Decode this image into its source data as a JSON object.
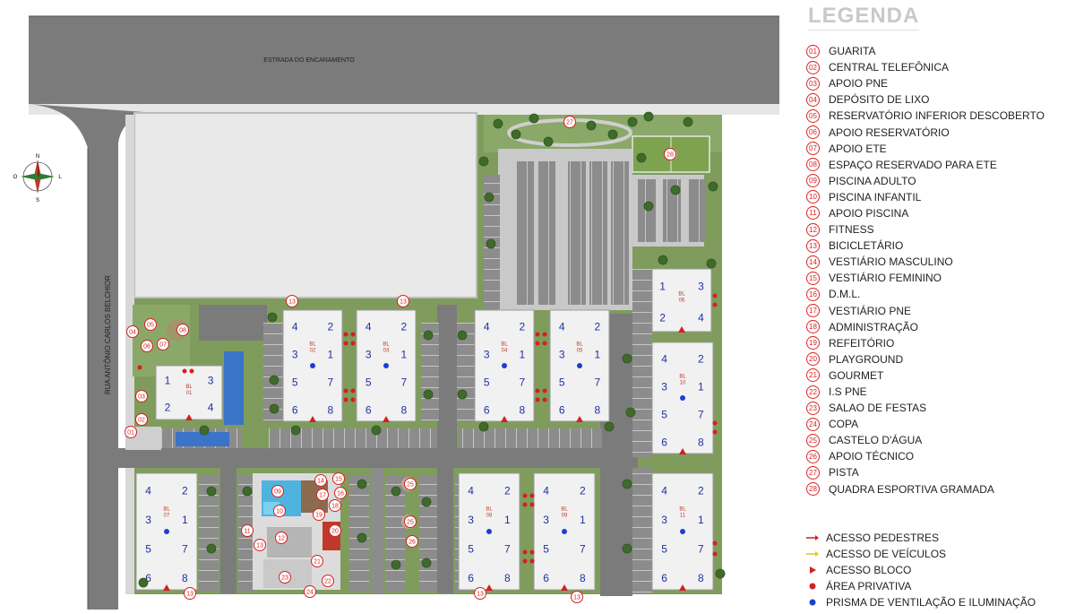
{
  "map": {
    "road_top": "ESTRADA DO ENCANAMENTO",
    "road_left": "RUA ANTÔNIO CARLOS BELCHIOR",
    "compass": {
      "n": "N",
      "s": "S",
      "l": "L",
      "o": "O"
    },
    "block_prefix": "BL",
    "blocks": [
      {
        "id": "01",
        "apts": [
          "1",
          "3",
          "2",
          "4"
        ]
      },
      {
        "id": "02",
        "apts": [
          "4",
          "2",
          "3",
          "1",
          "5",
          "7",
          "6",
          "8"
        ]
      },
      {
        "id": "03",
        "apts": [
          "4",
          "2",
          "3",
          "1",
          "5",
          "7",
          "6",
          "8"
        ]
      },
      {
        "id": "04",
        "apts": [
          "4",
          "2",
          "3",
          "1",
          "5",
          "7",
          "6",
          "8"
        ]
      },
      {
        "id": "05",
        "apts": [
          "4",
          "2",
          "3",
          "1",
          "5",
          "7",
          "6",
          "8"
        ]
      },
      {
        "id": "06",
        "apts": [
          "1",
          "3",
          "2",
          "4"
        ]
      },
      {
        "id": "07",
        "apts": [
          "4",
          "2",
          "3",
          "1",
          "5",
          "7",
          "6",
          "8"
        ]
      },
      {
        "id": "08",
        "apts": [
          "4",
          "2",
          "3",
          "1",
          "5",
          "7",
          "6",
          "8"
        ]
      },
      {
        "id": "09",
        "apts": [
          "4",
          "2",
          "3",
          "1",
          "5",
          "7",
          "6",
          "8"
        ]
      },
      {
        "id": "10",
        "apts": [
          "4",
          "2",
          "3",
          "1",
          "5",
          "7",
          "6",
          "8"
        ]
      },
      {
        "id": "11",
        "apts": [
          "4",
          "2",
          "3",
          "1",
          "5",
          "7",
          "6",
          "8"
        ]
      }
    ],
    "markers": [
      "01",
      "02",
      "03",
      "04",
      "05",
      "06",
      "07",
      "08",
      "09",
      "10",
      "11",
      "12",
      "13",
      "13",
      "13",
      "13",
      "13",
      "13",
      "14",
      "15",
      "16",
      "17",
      "18",
      "19",
      "20",
      "21",
      "22",
      "23",
      "24",
      "25",
      "25",
      "26",
      "27",
      "28"
    ]
  },
  "legend": {
    "title": "LEGENDA",
    "items": [
      {
        "num": "01",
        "label": "GUARITA"
      },
      {
        "num": "02",
        "label": "CENTRAL TELEFÔNICA"
      },
      {
        "num": "03",
        "label": "APOIO PNE"
      },
      {
        "num": "04",
        "label": "DEPÓSITO DE LIXO"
      },
      {
        "num": "05",
        "label": "RESERVATÓRIO INFERIOR DESCOBERTO"
      },
      {
        "num": "06",
        "label": "APOIO RESERVATÓRIO"
      },
      {
        "num": "07",
        "label": "APOIO ETE"
      },
      {
        "num": "08",
        "label": "ESPAÇO RESERVADO PARA ETE"
      },
      {
        "num": "09",
        "label": "PISCINA ADULTO"
      },
      {
        "num": "10",
        "label": "PISCINA INFANTIL"
      },
      {
        "num": "11",
        "label": "APOIO PISCINA"
      },
      {
        "num": "12",
        "label": "FITNESS"
      },
      {
        "num": "13",
        "label": "BICICLETÁRIO"
      },
      {
        "num": "14",
        "label": "VESTIÁRIO MASCULINO"
      },
      {
        "num": "15",
        "label": "VESTIÁRIO FEMININO"
      },
      {
        "num": "16",
        "label": "D.M.L."
      },
      {
        "num": "17",
        "label": "VESTIÁRIO PNE"
      },
      {
        "num": "18",
        "label": "ADMINISTRAÇÃO"
      },
      {
        "num": "19",
        "label": "REFEITÓRIO"
      },
      {
        "num": "20",
        "label": "PLAYGROUND"
      },
      {
        "num": "21",
        "label": "GOURMET"
      },
      {
        "num": "22",
        "label": "I.S PNE"
      },
      {
        "num": "23",
        "label": "SALAO DE FESTAS"
      },
      {
        "num": "24",
        "label": "COPA"
      },
      {
        "num": "25",
        "label": "CASTELO D'ÁGUA"
      },
      {
        "num": "26",
        "label": "APOIO TÉCNICO"
      },
      {
        "num": "27",
        "label": "PISTA"
      },
      {
        "num": "28",
        "label": "QUADRA ESPORTIVA GRAMADA"
      }
    ],
    "symbols": [
      {
        "kind": "arrow-red",
        "label": "ACESSO PEDESTRES",
        "color": "#d42020"
      },
      {
        "kind": "arrow-yellow",
        "label": "ACESSO DE VEÍCULOS",
        "color": "#e8c21a"
      },
      {
        "kind": "triangle",
        "label": "ACESSO BLOCO",
        "color": "#d42020"
      },
      {
        "kind": "dot-red",
        "label": "ÁREA PRIVATIVA",
        "color": "#d42020"
      },
      {
        "kind": "dot-blue",
        "label": "PRISMA DE VENTILAÇÃO E ILUMINAÇÃO",
        "color": "#1a3fd4"
      }
    ]
  },
  "colors": {
    "road": "#7b7b7b",
    "grass": "#7f9c5c",
    "paving": "#cfcfcf",
    "building": "#f1f1f1",
    "marker": "#d42020",
    "apt_number": "#2030a0"
  }
}
